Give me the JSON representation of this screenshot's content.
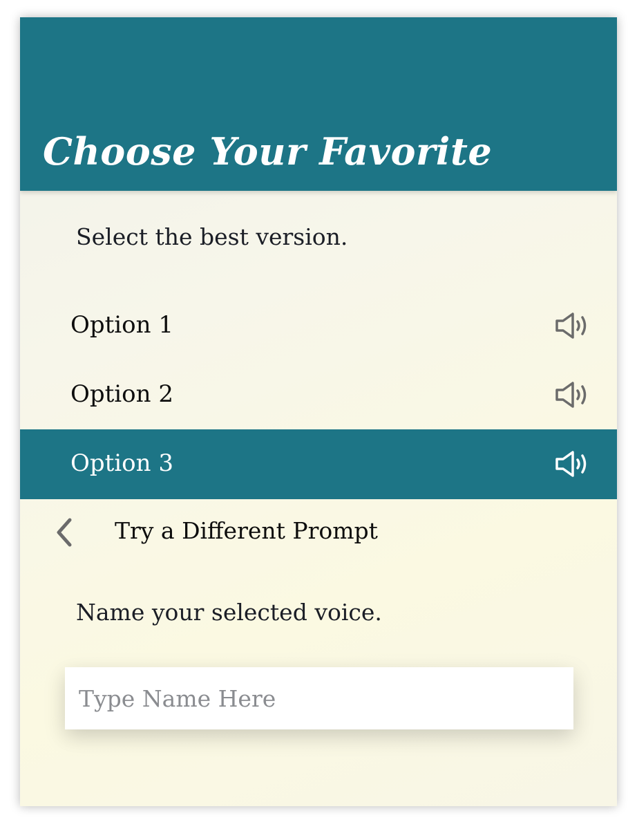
{
  "header": {
    "title": "Choose Your Favorite"
  },
  "instruction": "Select the best version.",
  "options": [
    {
      "label": "Option 1",
      "icon": "speaker-icon",
      "selected": false
    },
    {
      "label": "Option 2",
      "icon": "speaker-icon",
      "selected": false
    },
    {
      "label": "Option 3",
      "icon": "speaker-icon",
      "selected": true
    }
  ],
  "back": {
    "icon": "chevron-left-icon",
    "label": "Try a Different Prompt"
  },
  "name_section": {
    "label": "Name your selected voice.",
    "input_value": "",
    "input_placeholder": "Type Name Here"
  },
  "colors": {
    "accent": "#1d7586",
    "background": "#f8f6e6",
    "text": "#1b1e26",
    "icon_gray": "#6b6b6b",
    "icon_on_accent": "#ffffff"
  }
}
